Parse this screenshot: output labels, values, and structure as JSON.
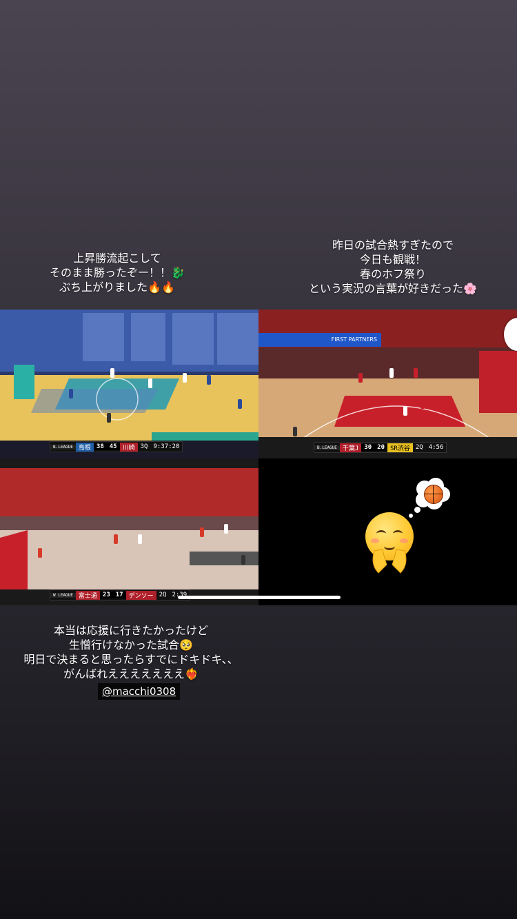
{
  "caption_left": {
    "line1": "上昇勝流起こして",
    "line2": "そのまま勝ったぞー！！",
    "line2_emoji": "🐉",
    "line3": "ぶち上がりました",
    "line3_emoji": "🔥🔥"
  },
  "caption_right": {
    "line1": "昨日の試合熱すぎたので",
    "line2": "今日も観戦！",
    "line3": "春のホフ祭り",
    "line4": "という実況の言葉が好きだった",
    "line4_emoji": "🌸"
  },
  "caption_bottom": {
    "line1": "本当は応援に行きたかったけど",
    "line2": "生憎行けなかった試合",
    "line2_emoji": "🥺",
    "line3": "明日で決まると思ったらすでにドキドキ、、",
    "line4": "がんばれえええええええ",
    "line4_emoji": "❤️‍🔥"
  },
  "mention": "@macchi0308",
  "tile1": {
    "league": "B.LEAGUE",
    "team1": "島根",
    "score1": "38",
    "score2": "45",
    "team2": "川崎",
    "period": "3Q",
    "clock": "9:37:20",
    "court_label": "B.LEAGUE"
  },
  "tile2": {
    "banner": "FIRST PARTNERS",
    "league": "B.LEAGUE",
    "team1": "千葉J",
    "score1": "30",
    "score2": "20",
    "team2": "SR渋谷",
    "period": "2Q",
    "clock": "4:56"
  },
  "tile3": {
    "league": "W LEAGUE",
    "team1": "富士通",
    "score1": "23",
    "score2": "17",
    "team2": "デンソー",
    "period": "2Q",
    "clock": "2:39"
  },
  "colors": {
    "team_blue": "#1f5fa8",
    "team_red": "#b0202a",
    "court_yellow": "#e8c25a",
    "court_wood": "#d6a877"
  }
}
